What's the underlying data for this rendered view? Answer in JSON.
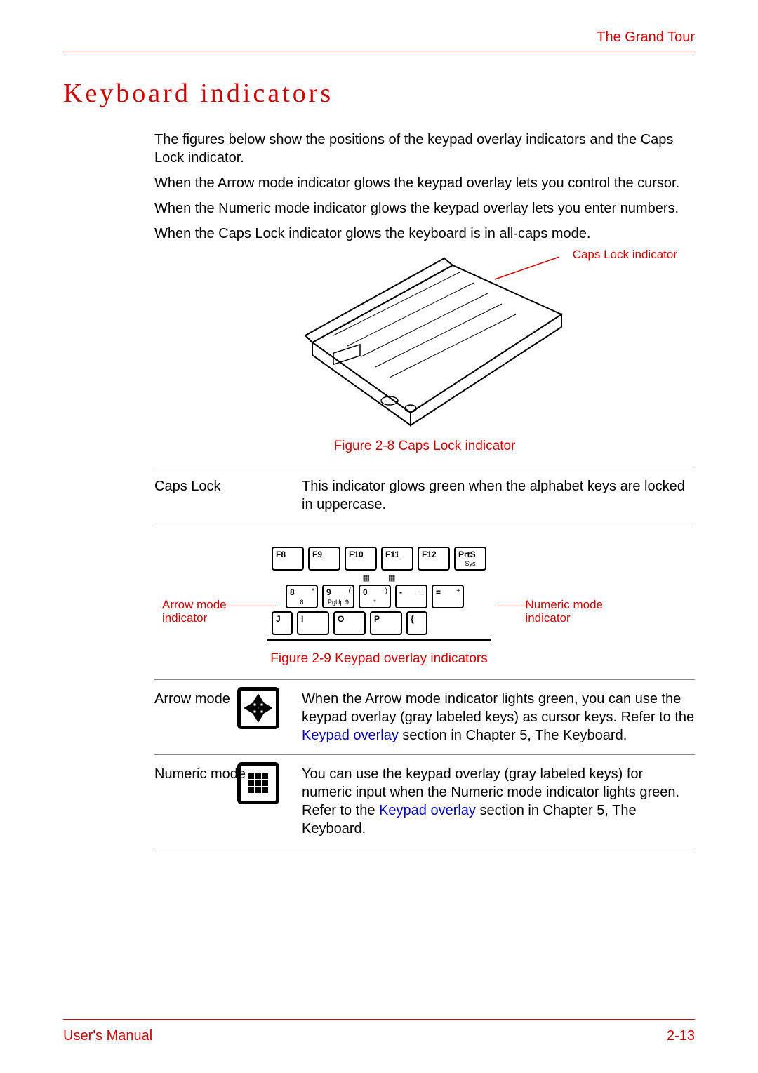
{
  "header": {
    "chapter": "The Grand Tour"
  },
  "section_title": "Keyboard indicators",
  "paragraphs": [
    "The figures below show the positions of the keypad overlay indicators and the Caps Lock indicator.",
    "When the Arrow mode indicator glows the keypad overlay lets you control the cursor.",
    "When the Numeric mode indicator glows the keypad overlay lets you enter numbers.",
    "When the Caps Lock indicator glows the keyboard is in all-caps mode."
  ],
  "figure1": {
    "caption": "Figure 2-8 Caps Lock indicator",
    "callout": "Caps Lock indicator"
  },
  "table1": {
    "term": "Caps Lock",
    "desc": "This indicator glows green when the alphabet keys are locked in uppercase."
  },
  "figure2": {
    "caption": "Figure 2-9 Keypad overlay indicators",
    "callout_left_line1": "Arrow mode",
    "callout_left_line2": "indicator",
    "callout_right_line1": "Numeric mode",
    "callout_right_line2": "indicator",
    "keys_row1": [
      "F8",
      "F9",
      "F10",
      "F11",
      "F12",
      "PrtS"
    ],
    "keys_row1_sub": [
      "",
      "",
      "",
      "",
      "",
      "Sys"
    ],
    "keys_row2_top": [
      "*",
      "(",
      ")",
      "_",
      "+"
    ],
    "keys_row2_main": [
      "8",
      "9",
      "0",
      "-",
      "="
    ],
    "keys_row2_sub": [
      "8",
      "PgUp   9",
      "*",
      "",
      ""
    ],
    "keys_row3": [
      "J",
      "I",
      "O",
      "P",
      "{"
    ]
  },
  "table2": [
    {
      "icon": "arrow-mode-icon",
      "term": "Arrow mode",
      "desc_before": "When the Arrow mode  indicator lights green, you can use the keypad overlay (gray labeled keys) as cursor keys. Refer to the ",
      "link": "Keypad overlay",
      "desc_after": " section in Chapter 5, The Keyboard."
    },
    {
      "icon": "numeric-mode-icon",
      "term": "Numeric mode",
      "desc_before": "You can use the keypad overlay (gray labeled keys) for numeric input when the Numeric mode indicator lights green. Refer to the ",
      "link": "Keypad overlay",
      "desc_after": " section in Chapter 5, The Keyboard."
    }
  ],
  "footer": {
    "left": "User's Manual",
    "right": "2-13"
  }
}
